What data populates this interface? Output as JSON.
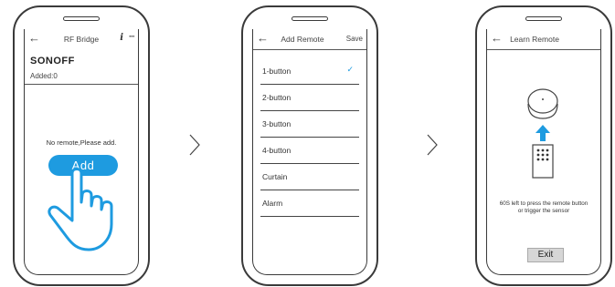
{
  "screens": [
    {
      "header": {
        "title": "RF Bridge",
        "info_icon": "i",
        "more_icon": "···"
      },
      "brand": "SONOFF",
      "added": "Added:0",
      "empty_message": "No remote,Please add.",
      "add_button": "Add"
    },
    {
      "header": {
        "title": "Add Remote",
        "save": "Save"
      },
      "options": [
        {
          "label": "1-button",
          "selected": true
        },
        {
          "label": "2-button",
          "selected": false
        },
        {
          "label": "3-button",
          "selected": false
        },
        {
          "label": "4-button",
          "selected": false
        },
        {
          "label": "Curtain",
          "selected": false
        },
        {
          "label": "Alarm",
          "selected": false
        }
      ],
      "check_mark": "✓"
    },
    {
      "header": {
        "title": "Learn Remote"
      },
      "instruction_line1": "60S left to press the remote button",
      "instruction_line2": "or trigger the sensor",
      "exit_button": "Exit"
    }
  ],
  "colors": {
    "accent": "#1e9be0",
    "outline": "#3a3a3a",
    "exit_bg": "#d6d6d6"
  },
  "icons": [
    "back-arrow-icon",
    "info-icon",
    "more-icon",
    "hand-pointer-icon",
    "check-icon",
    "rf-bridge-device-icon",
    "arrow-up-icon",
    "remote-control-icon",
    "chevron-right-icon"
  ]
}
